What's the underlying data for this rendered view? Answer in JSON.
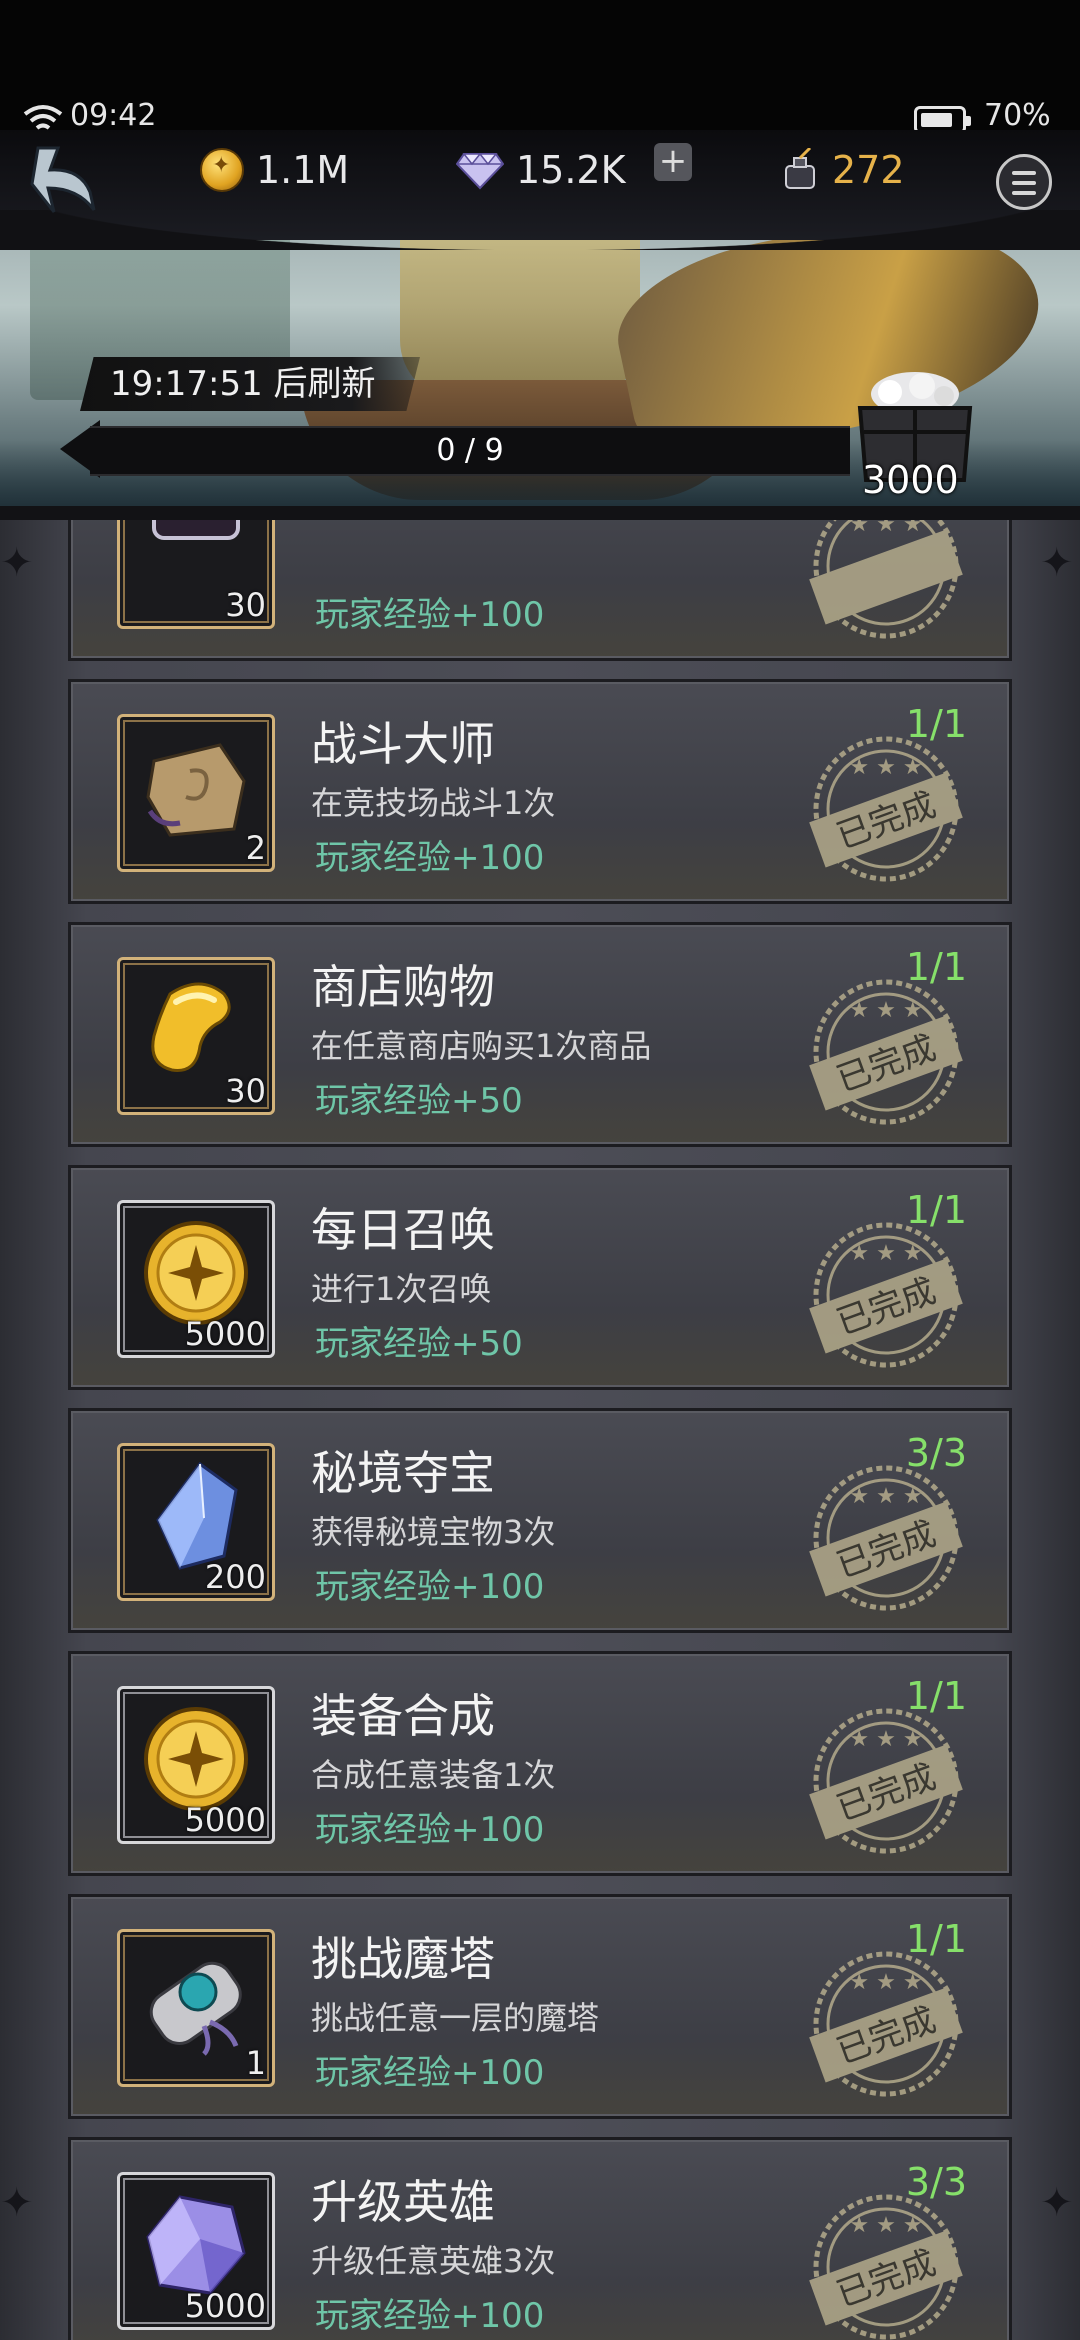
{
  "status_bar": {
    "time": "09:42",
    "battery": "70%"
  },
  "resources": {
    "gold": "1.1M",
    "gems": "15.2K",
    "ink": "272",
    "plus_label": "+"
  },
  "banner": {
    "timer": "19:17:51  后刷新",
    "progress": "0 / 9",
    "progress_fraction": 0,
    "chest_reward": "3000"
  },
  "colors": {
    "exp_text": "#6fc6a8",
    "progress_text": "#86e06a",
    "gold_frame": "#d2b27a",
    "silver_frame": "#d7d7da"
  },
  "tasks": [
    {
      "title": "",
      "desc": "",
      "exp": "玩家经验+100",
      "progress": "",
      "reward_count": "30",
      "icon": "potion-icon",
      "frame": "gold",
      "stamp": ""
    },
    {
      "title": "战斗大师",
      "desc": "在竞技场战斗1次",
      "exp": "玩家经验+100",
      "progress": "1/1",
      "reward_count": "2",
      "icon": "map-scroll-icon",
      "frame": "gold",
      "stamp": "已完成"
    },
    {
      "title": "商店购物",
      "desc": "在任意商店购买1次商品",
      "exp": "玩家经验+50",
      "progress": "1/1",
      "reward_count": "30",
      "icon": "gold-bean-icon",
      "frame": "gold",
      "stamp": "已完成"
    },
    {
      "title": "每日召唤",
      "desc": "进行1次召唤",
      "exp": "玩家经验+50",
      "progress": "1/1",
      "reward_count": "5000",
      "icon": "gold-coin-icon",
      "frame": "silver",
      "stamp": "已完成"
    },
    {
      "title": "秘境夺宝",
      "desc": "获得秘境宝物3次",
      "exp": "玩家经验+100",
      "progress": "3/3",
      "reward_count": "200",
      "icon": "blue-crystal-icon",
      "frame": "gold",
      "stamp": "已完成"
    },
    {
      "title": "装备合成",
      "desc": "合成任意装备1次",
      "exp": "玩家经验+100",
      "progress": "1/1",
      "reward_count": "5000",
      "icon": "gold-coin-icon",
      "frame": "silver",
      "stamp": "已完成"
    },
    {
      "title": "挑战魔塔",
      "desc": "挑战任意一层的魔塔",
      "exp": "玩家经验+100",
      "progress": "1/1",
      "reward_count": "1",
      "icon": "sealed-scroll-icon",
      "frame": "gold",
      "stamp": "已完成"
    },
    {
      "title": "升级英雄",
      "desc": "升级任意英雄3次",
      "exp": "玩家经验+100",
      "progress": "3/3",
      "reward_count": "5000",
      "icon": "purple-crystal-icon",
      "frame": "silver",
      "stamp": "已完成"
    }
  ]
}
